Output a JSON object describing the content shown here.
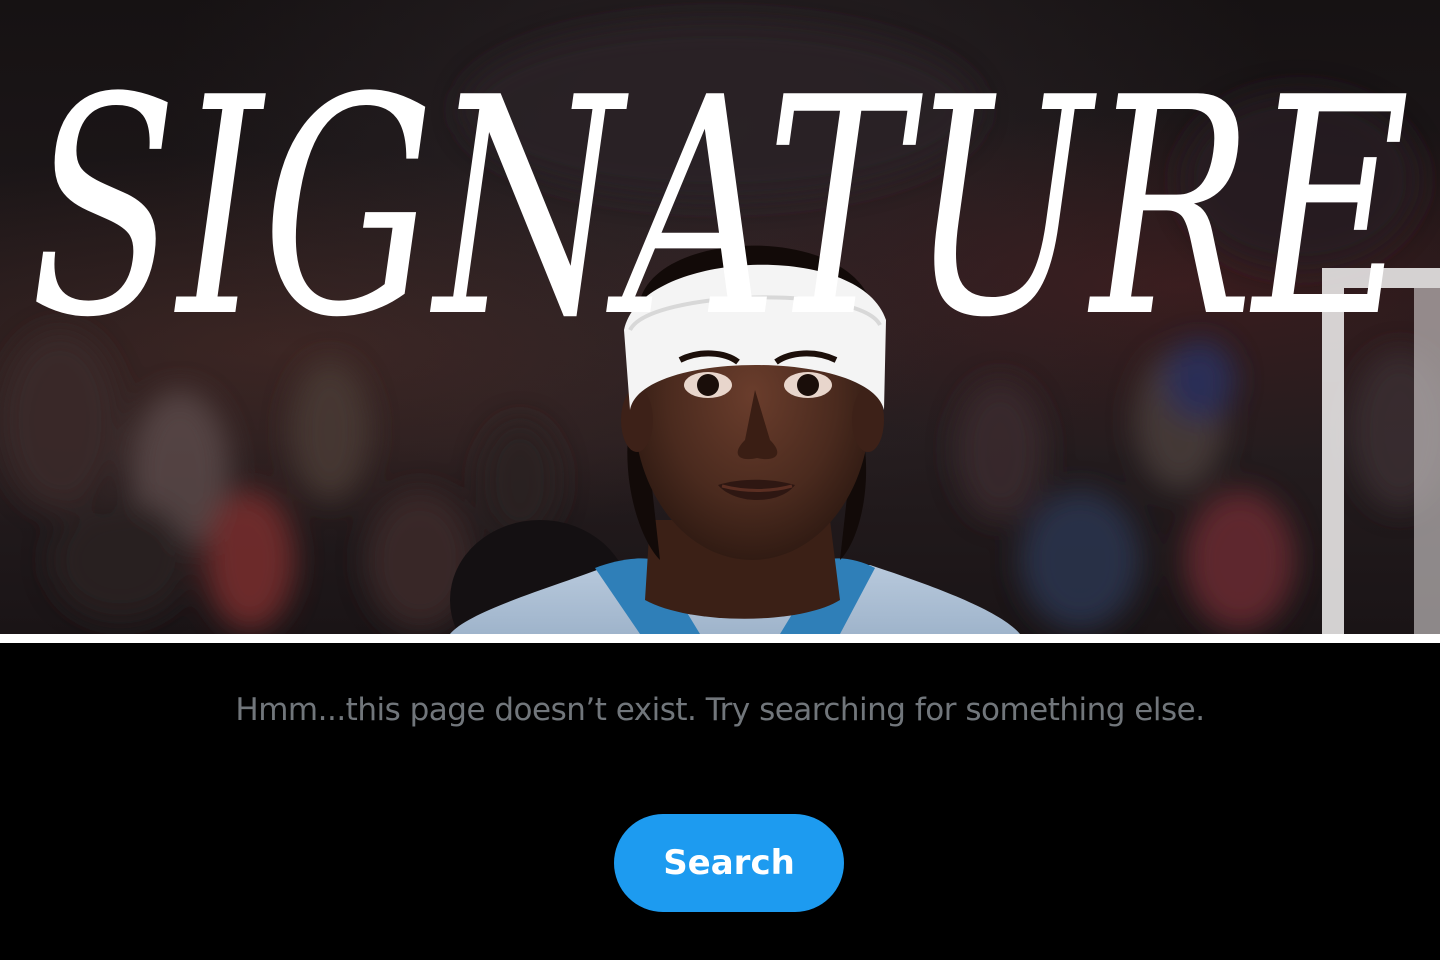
{
  "hero": {
    "logo_text": "SIGNATURE"
  },
  "error": {
    "message": "Hmm...this page doesn’t exist. Try searching for something else."
  },
  "actions": {
    "search_label": "Search"
  },
  "colors": {
    "background": "#000000",
    "message_text": "#71767b",
    "button": "#1d9bf0",
    "button_text": "#ffffff"
  }
}
